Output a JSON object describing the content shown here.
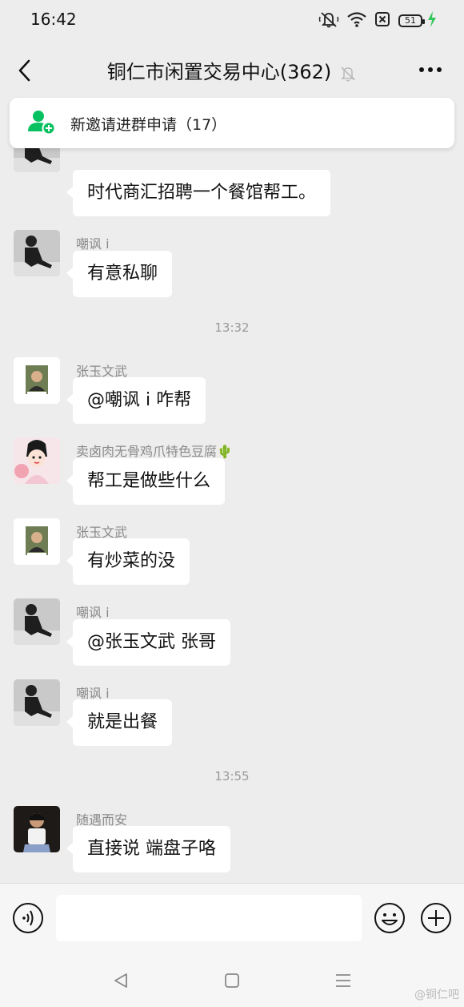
{
  "status_bar": {
    "time": "16:42",
    "battery": "51",
    "icons": [
      "mute-bell-icon",
      "wifi-icon",
      "sim-off-icon",
      "battery-icon",
      "charging-bolt-icon"
    ]
  },
  "header": {
    "title": "铜仁市闲置交易中心(362)",
    "icons": [
      "back-arrow-icon",
      "mute-bell-icon",
      "more-dots-icon"
    ]
  },
  "invite_banner": {
    "label": "新邀请进群申请（17）",
    "icon": "add-user-icon",
    "accent": "#07c160"
  },
  "messages": [
    {
      "type": "message",
      "sender": "",
      "text": "时代商汇招聘一个餐馆帮工。",
      "avatar": "dark-figure"
    },
    {
      "type": "message",
      "sender": "嘲讽 i",
      "text": "有意私聊",
      "avatar": "dark-figure"
    },
    {
      "type": "time",
      "text": "13:32"
    },
    {
      "type": "message",
      "sender": "张玉文武",
      "text": "@嘲讽 i 咋帮",
      "avatar": "portrait"
    },
    {
      "type": "message",
      "sender": "卖卤肉无骨鸡爪特色豆腐🌵",
      "text": "帮工是做些什么",
      "avatar": "cartoon-girl"
    },
    {
      "type": "message",
      "sender": "张玉文武",
      "text": "有炒菜的没",
      "avatar": "portrait"
    },
    {
      "type": "message",
      "sender": "嘲讽 i",
      "text": "@张玉文武  张哥",
      "avatar": "dark-figure"
    },
    {
      "type": "message",
      "sender": "嘲讽 i",
      "text": "就是出餐",
      "avatar": "dark-figure"
    },
    {
      "type": "time",
      "text": "13:55"
    },
    {
      "type": "message",
      "sender": "随遇而安_",
      "text": "直接说 端盘子咯",
      "avatar": "child-photo"
    }
  ],
  "input_bar": {
    "placeholder": "",
    "icons": [
      "voice-icon",
      "emoji-icon",
      "plus-icon"
    ]
  },
  "nav_bar": {
    "icons": [
      "nav-back-icon",
      "nav-home-icon",
      "nav-menu-icon"
    ]
  },
  "watermark": "@铜仁吧",
  "colors": {
    "background": "#ededed",
    "bubble": "#ffffff",
    "accent": "#07c160",
    "charging": "#35c759"
  }
}
